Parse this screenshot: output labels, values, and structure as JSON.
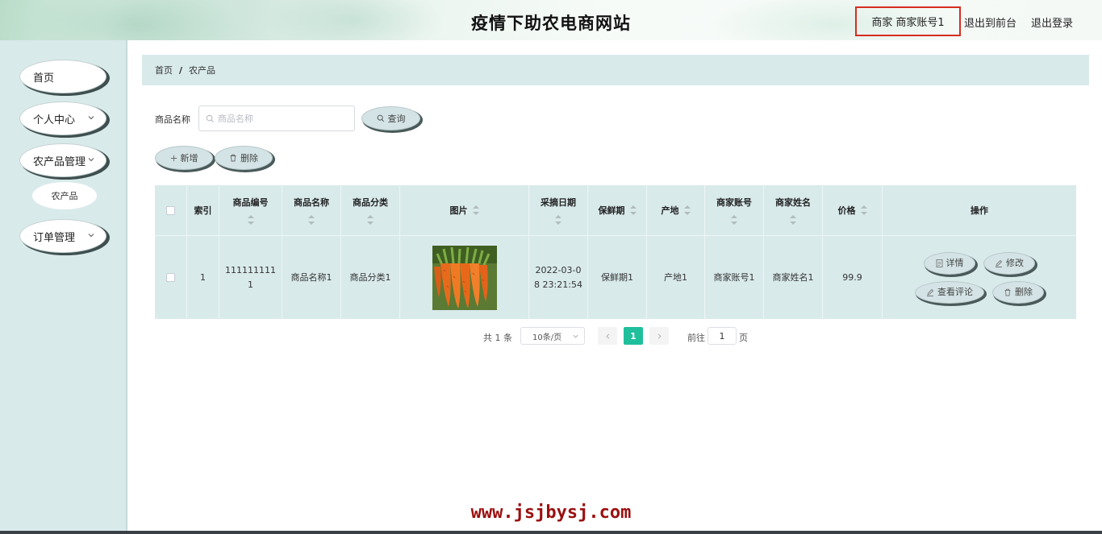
{
  "header": {
    "title": "疫情下助农电商网站",
    "role": "商家",
    "account": "商家账号1",
    "front_link": "退出到前台",
    "logout_link": "退出登录"
  },
  "sidebar": {
    "items": [
      {
        "label": "首页"
      },
      {
        "label": "个人中心"
      },
      {
        "label": "农产品管理"
      },
      {
        "label": "订单管理"
      }
    ],
    "sub_item": "农产品"
  },
  "breadcrumb": {
    "home": "首页",
    "separator": "/",
    "current": "农产品"
  },
  "search": {
    "label": "商品名称",
    "placeholder": "商品名称",
    "button": "查询"
  },
  "toolbar": {
    "add": "新增",
    "delete": "删除"
  },
  "table": {
    "headers": {
      "index": "索引",
      "code": "商品编号",
      "name": "商品名称",
      "category": "商品分类",
      "image": "图片",
      "date": "采摘日期",
      "shelf_life": "保鲜期",
      "origin": "产地",
      "account": "商家账号",
      "merchant": "商家姓名",
      "price": "价格",
      "ops": "操作"
    },
    "rows": [
      {
        "index": "1",
        "code_a": "111111111",
        "code_b": "1",
        "name": "商品名称1",
        "category": "商品分类1",
        "date_a": "2022-03-0",
        "date_b": "8 23:21:54",
        "shelf_life": "保鲜期1",
        "origin": "产地1",
        "account": "商家账号1",
        "merchant": "商家姓名1",
        "price": "99.9",
        "ops": {
          "detail": "详情",
          "edit": "修改",
          "comments": "查看评论",
          "delete": "删除"
        }
      }
    ]
  },
  "pagination": {
    "total": "共 1 条",
    "page_size": "10条/页",
    "current_page": "1",
    "goto_label": "前往",
    "goto_value": "1",
    "goto_unit": "页"
  },
  "watermark": "www.jsjbysj.com",
  "colors": {
    "accent": "#1fbf9c",
    "sidebar_bg": "#d9eaeb",
    "highlight_border": "#d62d20",
    "watermark": "#9a1010"
  }
}
